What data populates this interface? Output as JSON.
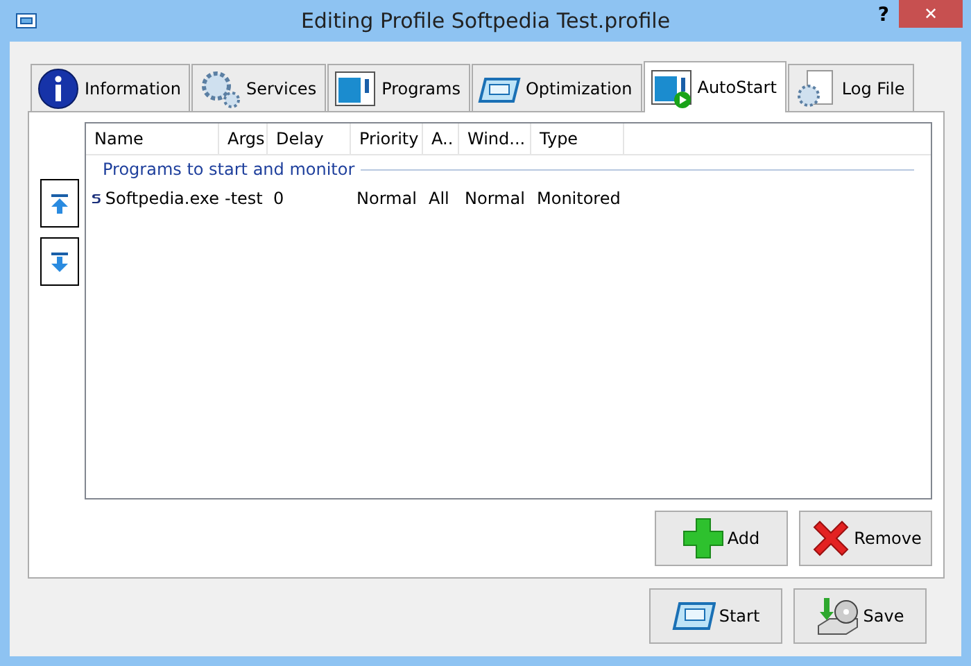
{
  "window": {
    "title": "Editing Profile Softpedia Test.profile",
    "help": "?",
    "close": "✕"
  },
  "tabs": [
    {
      "label": "Information",
      "selected": false
    },
    {
      "label": "Services",
      "selected": false
    },
    {
      "label": "Programs",
      "selected": false
    },
    {
      "label": "Optimization",
      "selected": false
    },
    {
      "label": "AutoStart",
      "selected": true
    },
    {
      "label": "Log File",
      "selected": false
    }
  ],
  "table": {
    "columns": [
      "Name",
      "Args",
      "Delay",
      "Priority",
      "A..",
      "Wind...",
      "Type"
    ],
    "group": "Programs to start and monitor",
    "rows": [
      {
        "cells": [
          "Softpedia.exe",
          "-test",
          "0",
          "Normal",
          "All",
          "Normal",
          "Monitored"
        ]
      }
    ]
  },
  "panel_buttons": [
    {
      "label": "Add",
      "kind": "add"
    },
    {
      "label": "Remove",
      "kind": "remove"
    }
  ],
  "footer_buttons": [
    {
      "label": "Start",
      "kind": "start"
    },
    {
      "label": "Save",
      "kind": "save"
    }
  ]
}
